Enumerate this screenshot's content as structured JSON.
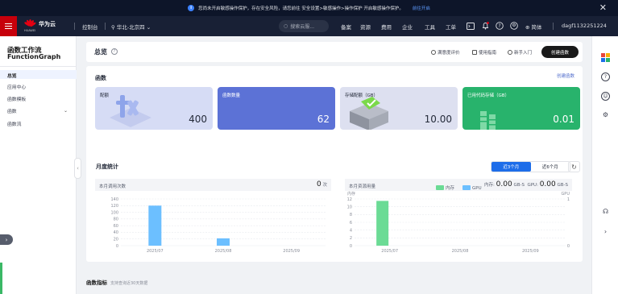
{
  "notice": {
    "text": "您尚未开启敏感操作保护，存在安全风险，请您前往 安全设置>敏感操作>操作保护 开启敏感操作保护。",
    "link": "前往开启"
  },
  "topnav": {
    "brand": "华为云",
    "brand_sub": "HUAWEI",
    "console": "控制台",
    "region": "华北-北京四",
    "search_placeholder": "搜索云服...",
    "links": [
      "备案",
      "资源",
      "费用",
      "企业",
      "工具",
      "工单"
    ],
    "language": "简体",
    "user": "dagf1132251224"
  },
  "sidebar": {
    "title": "函数工作流",
    "subtitle": "FunctionGraph",
    "items": [
      {
        "label": "总览",
        "active": true
      },
      {
        "label": "应用中心"
      },
      {
        "label": "函数模板"
      },
      {
        "label": "函数",
        "expandable": true
      },
      {
        "label": "函数流"
      }
    ]
  },
  "header": {
    "title": "总览",
    "links": [
      "满意度评价",
      "使用指南",
      "新手入门"
    ],
    "create_button": "创建函数"
  },
  "functions": {
    "title": "函数",
    "create_link": "创建函数",
    "cards": [
      {
        "label": "配额",
        "value": "400"
      },
      {
        "label": "函数数量",
        "value": "62"
      },
      {
        "label": "存储配额（GB）",
        "value": "10.00"
      },
      {
        "label": "已用代码存储（GB）",
        "value": "0.01"
      }
    ]
  },
  "monthly": {
    "title": "月度统计",
    "tabs": [
      "近3个月",
      "近6个月"
    ],
    "active_tab": 0,
    "calls_panel": {
      "label": "本月调用次数",
      "value": "0",
      "unit": "次"
    },
    "resource_panel": {
      "label": "本月资源用量",
      "memory_label": "内存:",
      "memory_value": "0.00",
      "memory_unit": "GB-S",
      "gpu_label": "GPU:",
      "gpu_value": "0.00",
      "gpu_unit": "GB-S"
    }
  },
  "metrics": {
    "title": "函数指标",
    "note": "支持查询近30天数据"
  },
  "colors": {
    "accent": "#1d6de9",
    "bar": "#6cbfff",
    "memory_bar": "#6bdb95",
    "gpu": "#6cbfff"
  },
  "chart_data": [
    {
      "type": "bar",
      "categories": [
        "2025/07",
        "2025/08",
        "2025/09"
      ],
      "series": [
        {
          "values": [
            120,
            22,
            0
          ]
        }
      ],
      "ylim": [
        0,
        140
      ],
      "yticks": [
        0,
        20,
        40,
        60,
        80,
        100,
        120,
        140
      ],
      "grid": true
    },
    {
      "type": "bar",
      "categories": [
        "2025/07",
        "2025/08",
        "2025/09"
      ],
      "series": [
        {
          "name": "内存",
          "values": [
            11.5,
            0,
            0
          ]
        },
        {
          "name": "GPU",
          "values": [
            0,
            0,
            0
          ]
        }
      ],
      "ylabel": "内存",
      "y2label": "GPU",
      "ylim": [
        0,
        12
      ],
      "yticks": [
        0,
        2,
        4,
        6,
        8,
        10,
        12
      ],
      "y2ticks": [
        0,
        1
      ],
      "legend": "top-center",
      "grid": true
    }
  ]
}
